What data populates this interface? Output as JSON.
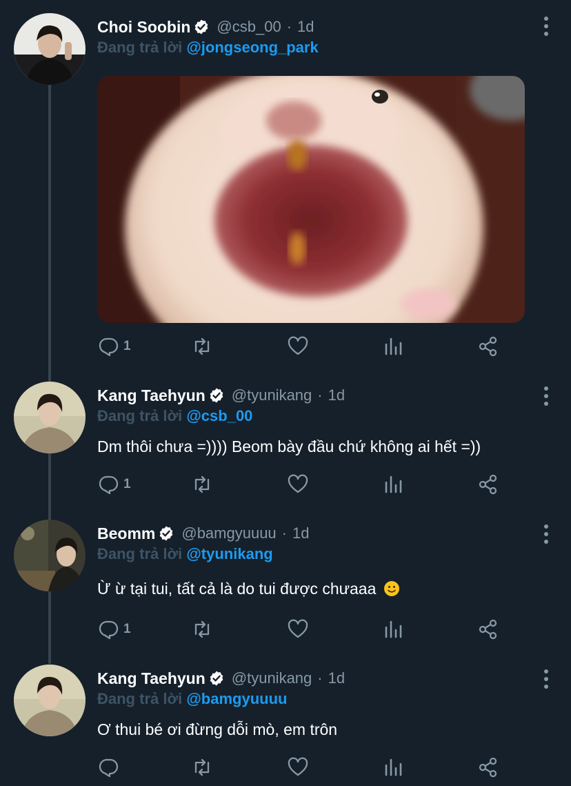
{
  "tweets": [
    {
      "name": "Choi Soobin",
      "handle": "@csb_00",
      "time": "1d",
      "reply_prefix": "Đang trả lời",
      "reply_to": "@jongseong_park",
      "text": "",
      "has_media": true,
      "reply_count": "1"
    },
    {
      "name": "Kang Taehyun",
      "handle": "@tyunikang",
      "time": "1d",
      "reply_prefix": "Đang trả lời",
      "reply_to": "@csb_00",
      "text": "Dm thôi chưa =)))) Beom bày đầu chứ không ai hết =))",
      "reply_count": "1"
    },
    {
      "name": "Beomm",
      "handle": "@bamgyuuuu",
      "time": "1d",
      "reply_prefix": "Đang trả lời",
      "reply_to": "@tyunikang",
      "text": "Ừ ừ tại tui, tất cả là do tui được chưaaa",
      "emoji": "slightly-smiling-face",
      "reply_count": "1"
    },
    {
      "name": "Kang Taehyun",
      "handle": "@tyunikang",
      "time": "1d",
      "reply_prefix": "Đang trả lời",
      "reply_to": "@bamgyuuuu",
      "text": "Ơ thui bé ơi đừng dỗi mò, em trôn",
      "reply_count": ""
    }
  ],
  "icons": {
    "reply": "reply-icon",
    "retweet": "retweet-icon",
    "like": "heart-icon",
    "analytics": "analytics-icon",
    "share": "share-icon",
    "more": "more-options-icon",
    "verified": "verified-badge-icon"
  },
  "colors": {
    "background": "#15202b",
    "link": "#1d9bf0",
    "secondary_text": "#8899a6",
    "thread_line": "#38444d"
  }
}
